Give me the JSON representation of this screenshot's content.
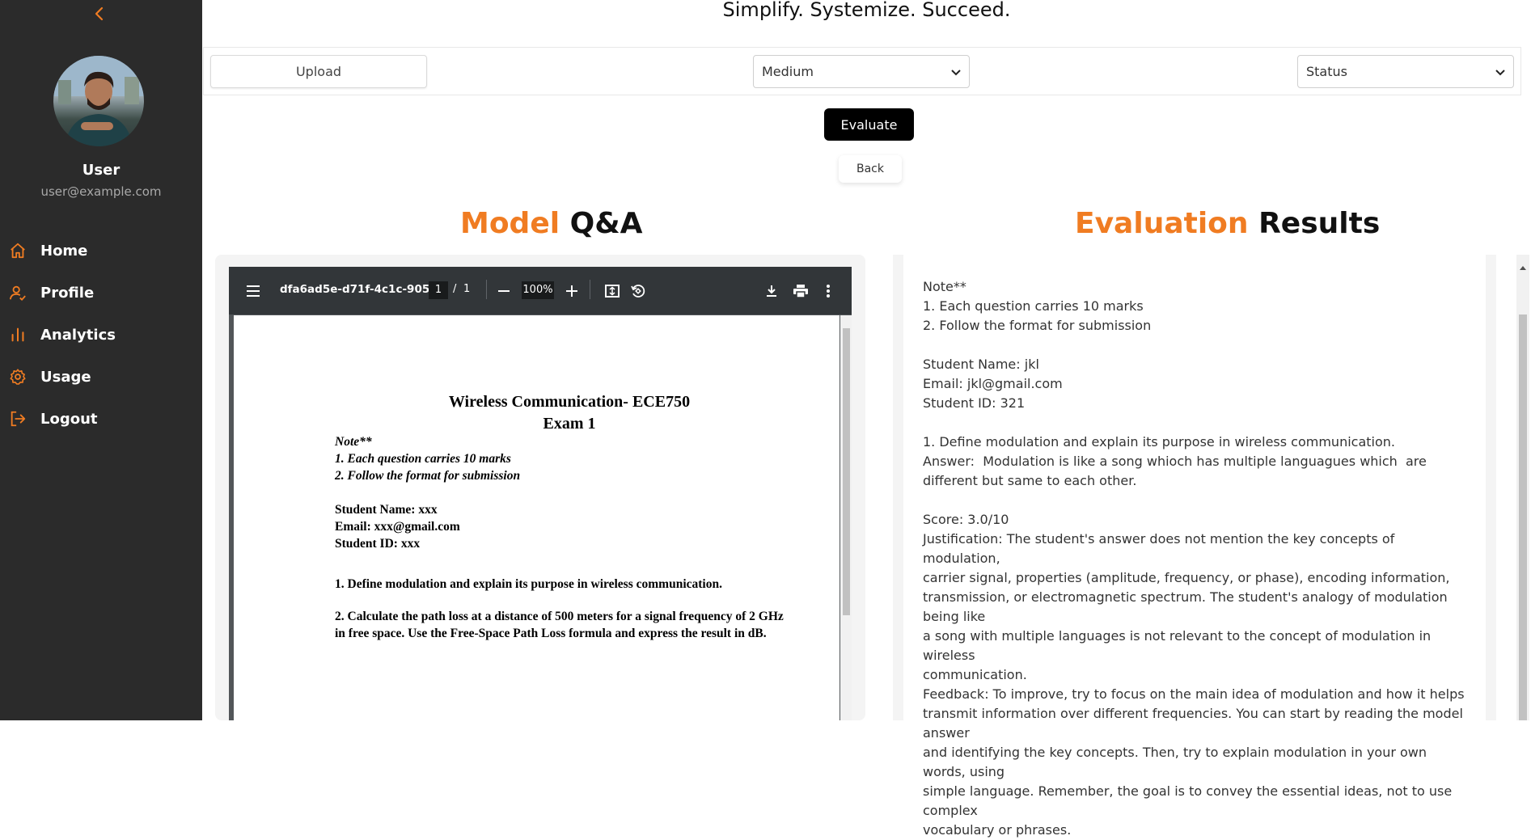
{
  "colors": {
    "accent": "#f07c22",
    "sidebar": "#2b2b2b"
  },
  "sidebar": {
    "collapse_icon": "chevron-left-icon",
    "user_name": "User",
    "user_email": "user@example.com",
    "items": [
      {
        "label": "Home",
        "icon": "home-icon"
      },
      {
        "label": "Profile",
        "icon": "profile-icon"
      },
      {
        "label": "Analytics",
        "icon": "analytics-icon"
      },
      {
        "label": "Usage",
        "icon": "gear-icon"
      },
      {
        "label": "Logout",
        "icon": "logout-icon"
      }
    ]
  },
  "header": {
    "tagline": "Simplify. Systemize. Succeed."
  },
  "toolbar": {
    "upload_label": "Upload",
    "difficulty_value": "Medium",
    "status_value": "Status"
  },
  "actions": {
    "evaluate_label": "Evaluate",
    "back_label": "Back"
  },
  "left_heading": {
    "accent": "Model",
    "rest": "Q&A"
  },
  "right_heading": {
    "accent": "Evaluation",
    "rest": "Results"
  },
  "pdf_viewer": {
    "filename": "dfa6ad5e-d71f-4c1c-905...",
    "page_current": "1",
    "page_separator": "/",
    "page_total": "1",
    "zoom": "100%",
    "document": {
      "title": "Wireless Communication- ECE750",
      "subtitle": "Exam 1",
      "note": "Note**",
      "note_1": "1. Each question carries 10 marks",
      "note_2": "2. Follow the format for submission",
      "student_name": "Student Name: xxx",
      "email": "Email: xxx@gmail.com",
      "student_id": "Student ID: xxx",
      "q1": "1. Define modulation and explain its purpose in wireless communication.",
      "q2_line1": "2. Calculate the path loss at a distance of 500 meters for a signal frequency of 2 GHz",
      "q2_line2": "in free space. Use the Free-Space Path Loss formula and express the result in dB."
    }
  },
  "results": {
    "text": "Note**\n1. Each question carries 10 marks\n2. Follow the format for submission\n\nStudent Name: jkl\nEmail: jkl@gmail.com\nStudent ID: 321\n\n1. Define modulation and explain its purpose in wireless communication.\nAnswer:  Modulation is like a song whioch has multiple languagues which  are\ndifferent but same to each other.\n\nScore: 3.0/10\nJustification: The student's answer does not mention the key concepts of modulation,\ncarrier signal, properties (amplitude, frequency, or phase), encoding information,\ntransmission, or electromagnetic spectrum. The student's analogy of modulation being like\na song with multiple languages is not relevant to the concept of modulation in wireless\ncommunication.\nFeedback: To improve, try to focus on the main idea of modulation and how it helps\ntransmit information over different frequencies. You can start by reading the model answer\nand identifying the key concepts. Then, try to explain modulation in your own words, using\nsimple language. Remember, the goal is to convey the essential ideas, not to use complex\nvocabulary or phrases."
  }
}
